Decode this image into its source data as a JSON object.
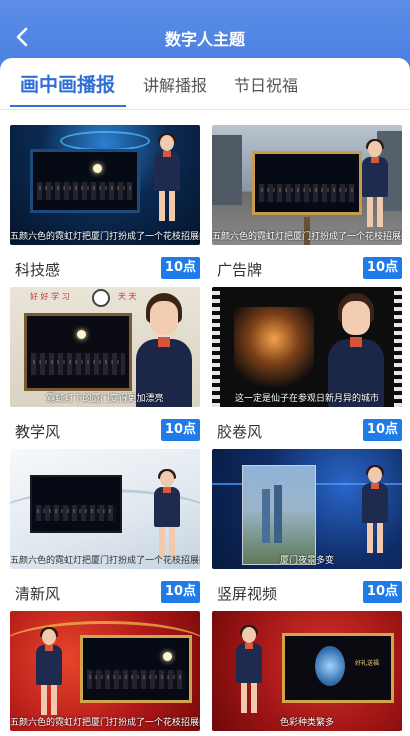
{
  "header": {
    "title": "数字人主题",
    "back_icon": "chevron-left-icon"
  },
  "tabs": [
    {
      "label": "画中画播报",
      "active": true
    },
    {
      "label": "讲解播报",
      "active": false
    },
    {
      "label": "节日祝福",
      "active": false
    }
  ],
  "cards": [
    {
      "name": "科技感",
      "price": "10点",
      "subtitle": "五颜六色的霓虹灯把厦门打扮成了一个花枝招展的仙子"
    },
    {
      "name": "广告牌",
      "price": "10点",
      "subtitle": "五颜六色的霓虹灯把厦门打扮成了一个花枝招展的仙子"
    },
    {
      "name": "教学风",
      "price": "10点",
      "subtitle": "霓虹灯下的厦门变得更加漂亮",
      "board_text_left": "好 好 学 习",
      "board_text_right": "天 天"
    },
    {
      "name": "胶卷风",
      "price": "10点",
      "subtitle": "这一定是仙子在参观日新月异的城市"
    },
    {
      "name": "清新风",
      "price": "10点",
      "subtitle": "五颜六色的霓虹灯把厦门打扮成了一个花枝招展的仙子"
    },
    {
      "name": "竖屏视频",
      "price": "10点",
      "subtitle": "厦门夜景多变"
    },
    {
      "name": "",
      "price": "",
      "subtitle": "五颜六色的霓虹灯把厦门打扮成了一个花枝招展的仙子"
    },
    {
      "name": "",
      "price": "",
      "subtitle": "色彩种类繁多",
      "sign_text": "好礼送福"
    }
  ],
  "colors": {
    "header": "#4a7fe0",
    "accent": "#2f6fd6",
    "badge": "#1f7be8"
  }
}
